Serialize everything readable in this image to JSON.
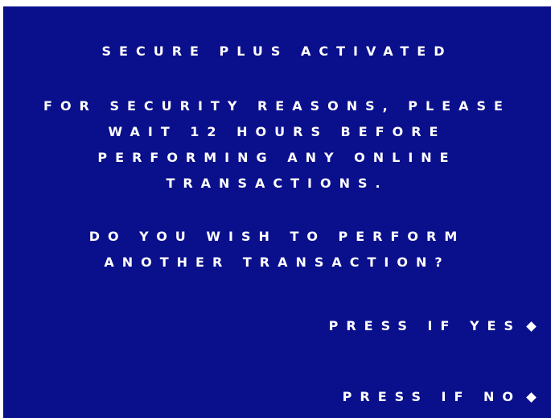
{
  "screen": {
    "title": "SECURE PLUS ACTIVATED",
    "message_lines": [
      "FOR SECURITY REASONS, PLEASE",
      "WAIT 12 HOURS BEFORE",
      "PERFORMING ANY ONLINE",
      "TRANSACTIONS."
    ],
    "question_lines": [
      "DO YOU WISH TO PERFORM",
      "ANOTHER TRANSACTION?"
    ],
    "options": {
      "yes_label": "PRESS IF YES",
      "no_label": "PRESS IF NO"
    },
    "option_marker_icon": "diamond-icon",
    "colors": {
      "background": "#0a0f8c",
      "text": "#ffffff"
    }
  }
}
